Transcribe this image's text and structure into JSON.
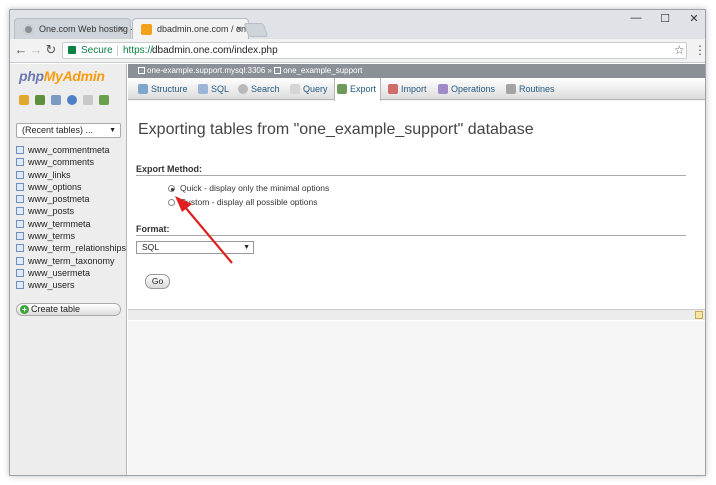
{
  "browser": {
    "tabs": [
      {
        "title": "One.com Web hosting -",
        "close": "×"
      },
      {
        "title": "dbadmin.one.com / one",
        "close": "×"
      }
    ],
    "window_controls": {
      "minimize": "—",
      "maximize": "☐",
      "close": "✕"
    },
    "address": {
      "secure_label": "Secure",
      "url_scheme": "https://",
      "url_rest": "dbadmin.one.com/index.php"
    }
  },
  "pma": {
    "logo_php": "php",
    "logo_myadmin": "MyAdmin",
    "recent_tables": "(Recent tables) ...",
    "tables": [
      "www_commentmeta",
      "www_comments",
      "www_links",
      "www_options",
      "www_postmeta",
      "www_posts",
      "www_termmeta",
      "www_terms",
      "www_term_relationships",
      "www_term_taxonomy",
      "www_usermeta",
      "www_users"
    ],
    "create_table": "Create table",
    "breadcrumb": {
      "server": "one-example.support.mysql:3306",
      "separator": "»",
      "database": "one_example_support"
    },
    "tabs": [
      "Structure",
      "SQL",
      "Search",
      "Query",
      "Export",
      "Import",
      "Operations",
      "Routines"
    ],
    "active_tab": "Export",
    "page_title": "Exporting tables from \"one_example_support\" database",
    "export_method_label": "Export Method:",
    "options": {
      "quick": "Quick - display only the minimal options",
      "custom": "Custom - display all possible options"
    },
    "format_label": "Format:",
    "format_value": "SQL",
    "go_button": "Go"
  },
  "colors": {
    "accent_red": "#e02020",
    "breadcrumb_bg": "#8b9097",
    "link_blue": "#235a81"
  }
}
